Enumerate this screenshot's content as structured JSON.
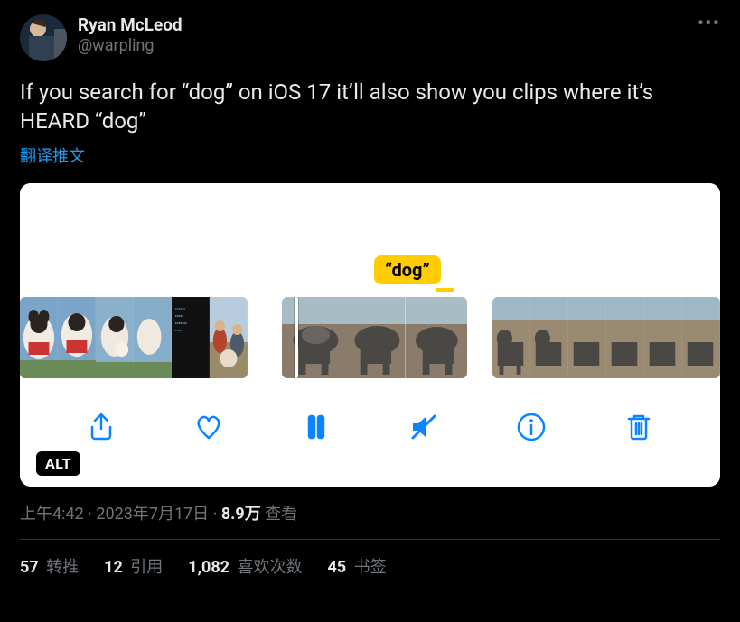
{
  "author": {
    "display_name": "Ryan McLeod",
    "handle": "@warpling"
  },
  "tweet_text": "If you search for “dog” on iOS 17 it’ll also show you clips where it’s HEARD “dog”",
  "translate_label": "翻译推文",
  "media": {
    "search_pill": "“dog”",
    "alt_badge": "ALT"
  },
  "timestamp": {
    "time": "上午4:42",
    "sep1": " · ",
    "date": "2023年7月17日",
    "sep2": " · ",
    "views_count": "8.9万",
    "views_label": " 查看"
  },
  "stats": {
    "retweets_count": "57",
    "retweets_label": " 转推",
    "quotes_count": "12",
    "quotes_label": " 引用",
    "likes_count": "1,082",
    "likes_label": " 喜欢次数",
    "bookmarks_count": "45",
    "bookmarks_label": " 书签"
  }
}
